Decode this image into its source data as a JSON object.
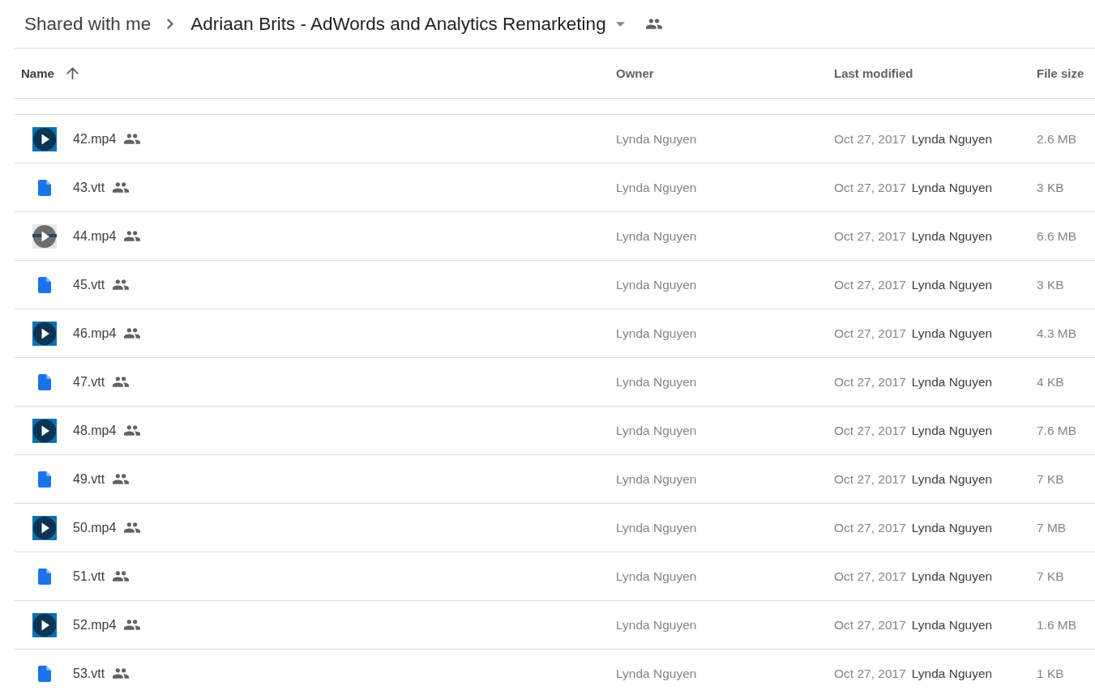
{
  "breadcrumb": {
    "parent": "Shared with me",
    "current": "Adriaan Brits - AdWords and Analytics Remarketing",
    "shared": true
  },
  "table": {
    "columns": [
      {
        "label": "Name",
        "sorted": true,
        "ascending": true
      },
      {
        "label": "Owner",
        "sorted": false
      },
      {
        "label": "Last modified",
        "sorted": false
      },
      {
        "label": "File size",
        "sorted": false
      }
    ],
    "rows": [
      {
        "kind": "video",
        "name": "42.mp4",
        "shared": true,
        "owner": "Lynda Nguyen",
        "modified_date": "Oct 27, 2017",
        "modified_by": "Lynda Nguyen",
        "size": "2.6 MB"
      },
      {
        "kind": "document",
        "name": "43.vtt",
        "shared": true,
        "owner": "Lynda Nguyen",
        "modified_date": "Oct 27, 2017",
        "modified_by": "Lynda Nguyen",
        "size": "3 KB"
      },
      {
        "kind": "video-frame",
        "name": "44.mp4",
        "shared": true,
        "owner": "Lynda Nguyen",
        "modified_date": "Oct 27, 2017",
        "modified_by": "Lynda Nguyen",
        "size": "6.6 MB"
      },
      {
        "kind": "document",
        "name": "45.vtt",
        "shared": true,
        "owner": "Lynda Nguyen",
        "modified_date": "Oct 27, 2017",
        "modified_by": "Lynda Nguyen",
        "size": "3 KB"
      },
      {
        "kind": "video",
        "name": "46.mp4",
        "shared": true,
        "owner": "Lynda Nguyen",
        "modified_date": "Oct 27, 2017",
        "modified_by": "Lynda Nguyen",
        "size": "4.3 MB"
      },
      {
        "kind": "document",
        "name": "47.vtt",
        "shared": true,
        "owner": "Lynda Nguyen",
        "modified_date": "Oct 27, 2017",
        "modified_by": "Lynda Nguyen",
        "size": "4 KB"
      },
      {
        "kind": "video",
        "name": "48.mp4",
        "shared": true,
        "owner": "Lynda Nguyen",
        "modified_date": "Oct 27, 2017",
        "modified_by": "Lynda Nguyen",
        "size": "7.6 MB"
      },
      {
        "kind": "document",
        "name": "49.vtt",
        "shared": true,
        "owner": "Lynda Nguyen",
        "modified_date": "Oct 27, 2017",
        "modified_by": "Lynda Nguyen",
        "size": "7 KB"
      },
      {
        "kind": "video",
        "name": "50.mp4",
        "shared": true,
        "owner": "Lynda Nguyen",
        "modified_date": "Oct 27, 2017",
        "modified_by": "Lynda Nguyen",
        "size": "7 MB"
      },
      {
        "kind": "document",
        "name": "51.vtt",
        "shared": true,
        "owner": "Lynda Nguyen",
        "modified_date": "Oct 27, 2017",
        "modified_by": "Lynda Nguyen",
        "size": "7 KB"
      },
      {
        "kind": "video",
        "name": "52.mp4",
        "shared": true,
        "owner": "Lynda Nguyen",
        "modified_date": "Oct 27, 2017",
        "modified_by": "Lynda Nguyen",
        "size": "1.6 MB"
      },
      {
        "kind": "document",
        "name": "53.vtt",
        "shared": true,
        "owner": "Lynda Nguyen",
        "modified_date": "Oct 27, 2017",
        "modified_by": "Lynda Nguyen",
        "size": "1 KB"
      }
    ]
  }
}
